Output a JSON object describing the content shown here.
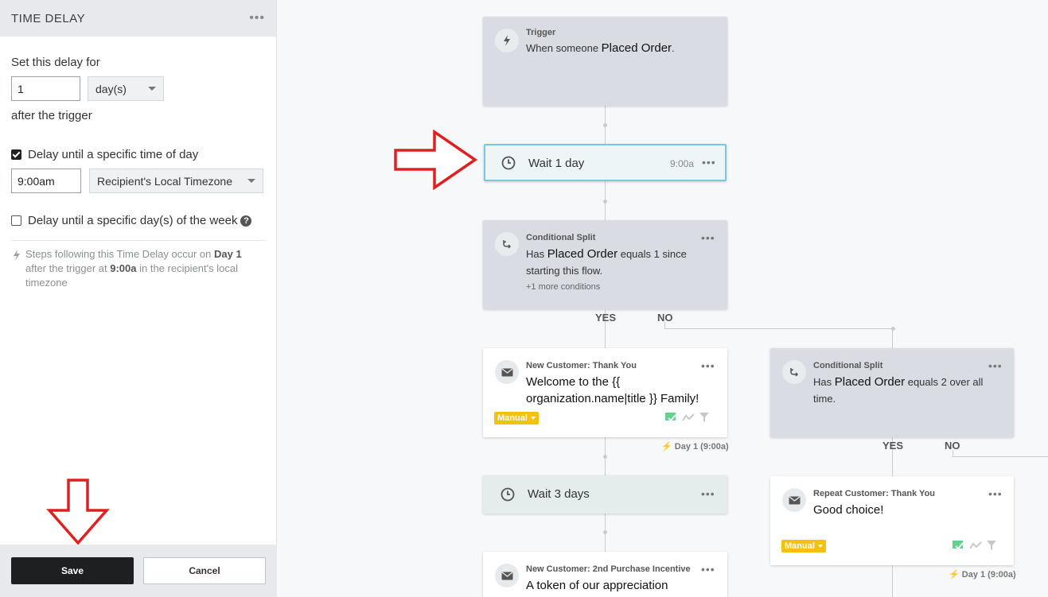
{
  "sidebar": {
    "title": "TIME DELAY",
    "delay_label": "Set this delay for",
    "delay_value": "1",
    "delay_unit": "day(s)",
    "after_label": "after the trigger",
    "time_of_day_label": "Delay until a specific time of day",
    "time_of_day_checked": true,
    "time_value": "9:00am",
    "timezone": "Recipient's Local Timezone",
    "day_of_week_label": "Delay until a specific day(s) of the week",
    "day_of_week_checked": false,
    "note_pre": "Steps following this Time Delay occur on ",
    "note_day": "Day 1",
    "note_mid": " after the trigger at ",
    "note_time": "9:00a",
    "note_post": " in the recipient's local timezone",
    "save_label": "Save",
    "cancel_label": "Cancel"
  },
  "flow": {
    "trigger": {
      "title": "Trigger",
      "text_pre": "When someone ",
      "text_bold": "Placed Order",
      "text_post": "."
    },
    "wait1": {
      "label": "Wait 1 day",
      "time": "9:00a"
    },
    "split1": {
      "title": "Conditional Split",
      "pre": "Has ",
      "metric": "Placed Order",
      "post": " equals 1 since",
      "line2": "starting this flow.",
      "more": "+1 more conditions"
    },
    "yes1": "YES",
    "no1": "NO",
    "email1": {
      "title": "New Customer: Thank You",
      "line1": "Welcome to the {{",
      "line2": "organization.name|title }} Family!",
      "badge": "Manual",
      "day": "Day 1 (9:00a)"
    },
    "split2": {
      "title": "Conditional Split",
      "pre": "Has ",
      "metric": "Placed Order",
      "post": " equals 2 over all",
      "line2": "time."
    },
    "yes2": "YES",
    "no2": "NO",
    "wait2": {
      "label": "Wait 3 days"
    },
    "email2": {
      "title": "Repeat Customer: Thank You",
      "line1": "Good choice!",
      "badge": "Manual",
      "day": "Day 1 (9:00a)"
    },
    "email3": {
      "title": "New Customer: 2nd Purchase Incentive",
      "line1": "A token of our appreciation"
    }
  },
  "icons": [
    "more-icon",
    "caret-down-icon",
    "checkbox-icon",
    "help-icon",
    "bolt-icon",
    "clock-icon",
    "split-icon",
    "mail-icon",
    "smart-sending-icon",
    "analytics-icon",
    "filter-icon",
    "red-arrow-right-icon",
    "red-arrow-down-icon"
  ],
  "colors": {
    "accent_yellow": "#f4c20d",
    "selected_border": "#7fc3df",
    "arrow_red": "#e02020",
    "card_grey": "#d9dde3"
  }
}
